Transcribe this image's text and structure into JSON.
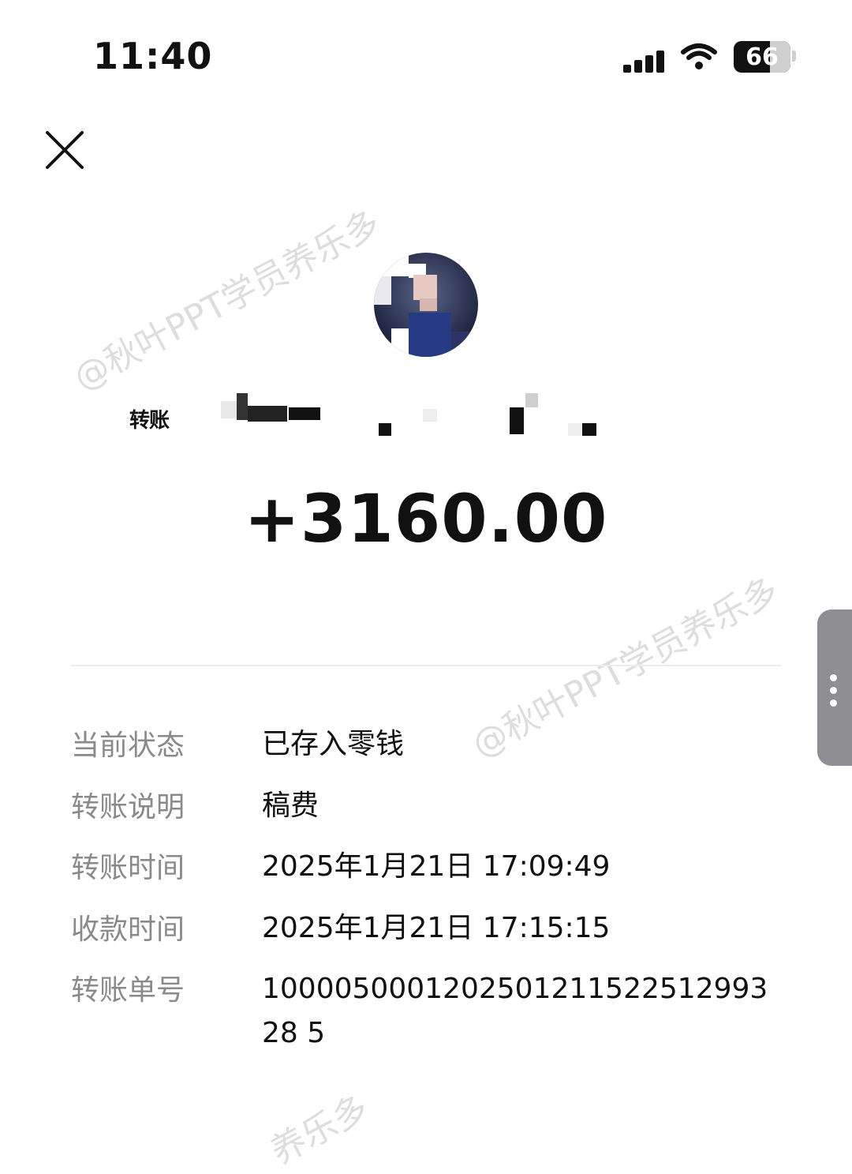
{
  "status_bar": {
    "time": "11:40",
    "battery_percent": "66",
    "signal_icon": "cellular-signal-icon",
    "wifi_icon": "wifi-icon"
  },
  "header": {
    "close_icon": "close-icon"
  },
  "payer": {
    "avatar_icon": "avatar",
    "name_visible": "转账"
  },
  "transaction": {
    "amount": "+3160.00"
  },
  "details": [
    {
      "label": "当前状态",
      "value": "已存入零钱"
    },
    {
      "label": "转账说明",
      "value": "稿费"
    },
    {
      "label": "转账时间",
      "value": "2025年1月21日 17:09:49"
    },
    {
      "label": "收款时间",
      "value": "2025年1月21日 17:15:15"
    },
    {
      "label": "转账单号",
      "value": "100005000120250121152251299328 5"
    }
  ],
  "watermark": {
    "text": "@秋叶PPT学员养乐多",
    "text_partial": "养乐多"
  },
  "colors": {
    "background": "#ffffff",
    "label": "#8a8a8a",
    "text": "#111111",
    "divider": "#ececec"
  }
}
